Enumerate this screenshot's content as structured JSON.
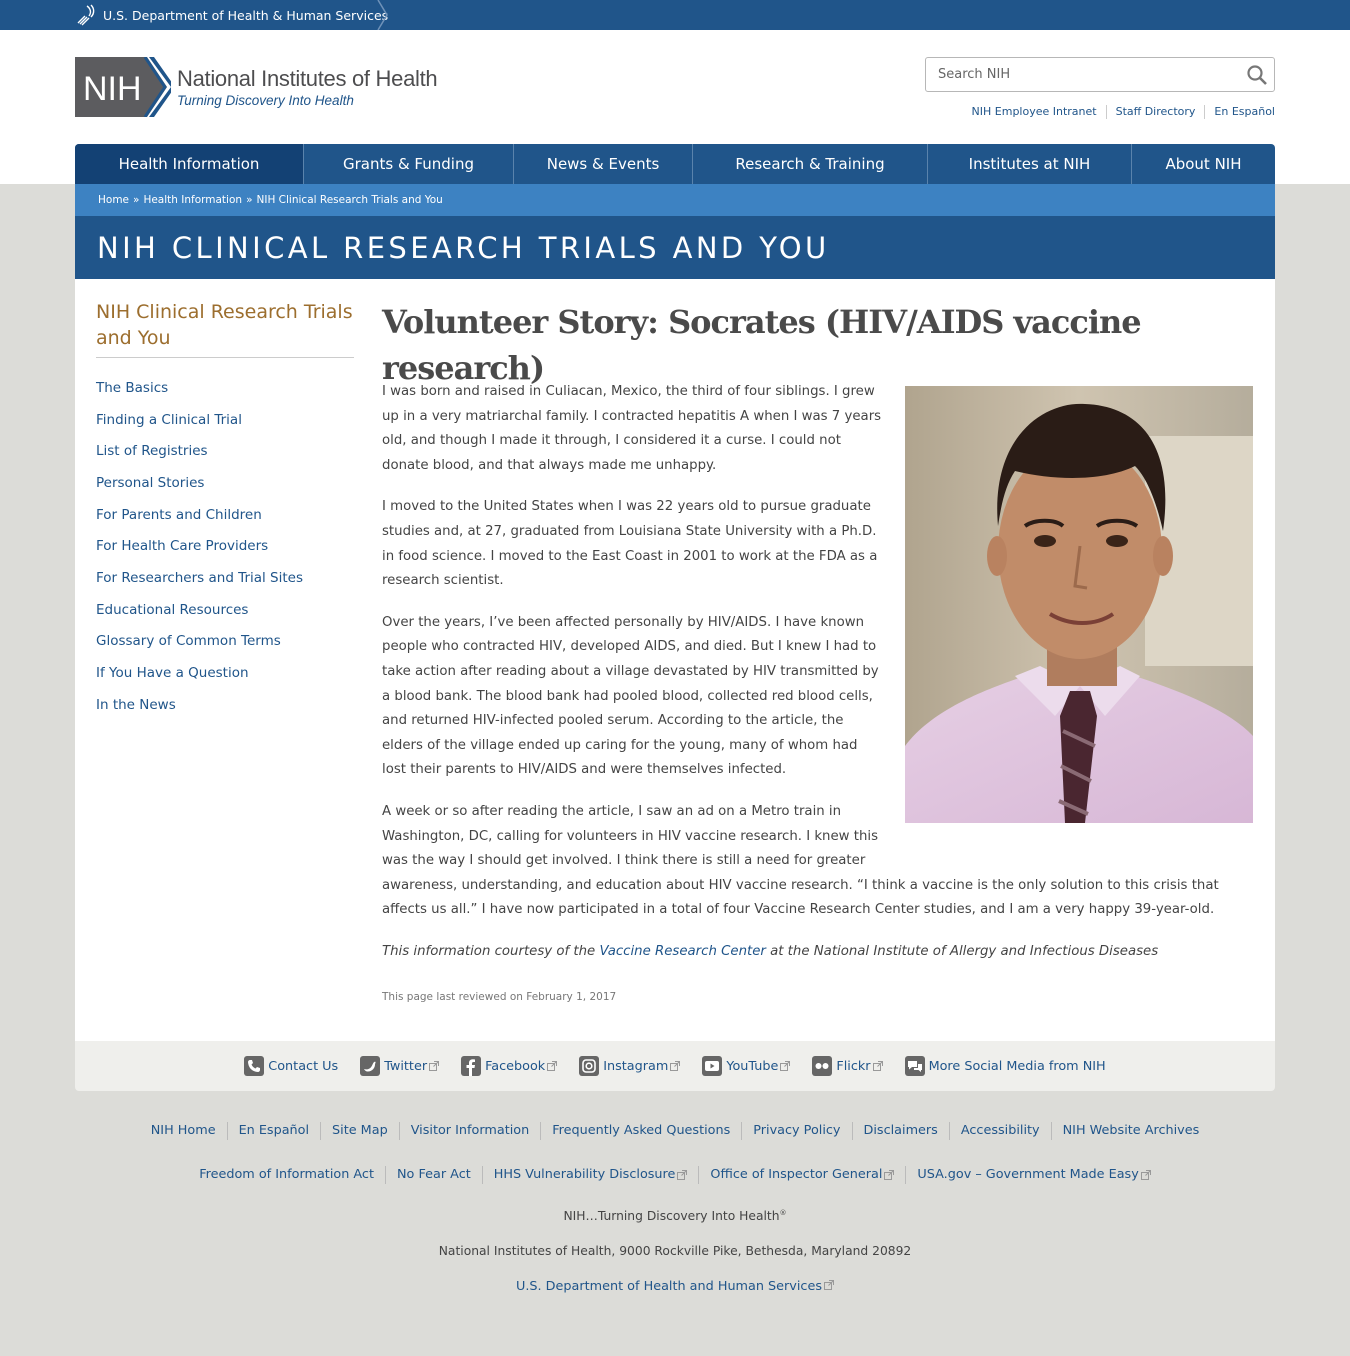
{
  "hhs": {
    "label": "U.S. Department of Health & Human Services"
  },
  "logo": {
    "mark": "NIH",
    "title": "National Institutes of Health",
    "tagline": "Turning Discovery Into Health"
  },
  "search": {
    "placeholder": "Search NIH"
  },
  "util_links": [
    "NIH Employee Intranet",
    "Staff Directory",
    "En Español"
  ],
  "nav": [
    "Health Information",
    "Grants & Funding",
    "News & Events",
    "Research & Training",
    "Institutes at NIH",
    "About NIH"
  ],
  "breadcrumb": [
    "Home",
    "Health Information",
    "NIH Clinical Research Trials and You"
  ],
  "breadcrumb_sep": "»",
  "section_title": "NIH CLINICAL RESEARCH TRIALS AND YOU",
  "sidebar": {
    "title": "NIH Clinical Research Trials and You",
    "items": [
      "The Basics",
      "Finding a Clinical Trial",
      "List of Registries",
      "Personal Stories",
      "For Parents and Children",
      "For Health Care Providers",
      "For Researchers and Trial Sites",
      "Educational Resources",
      "Glossary of Common Terms",
      "If You Have a Question",
      "In the News"
    ]
  },
  "article": {
    "heading": "Volunteer Story: Socrates (HIV/AIDS vaccine research)",
    "p1": "I was born and raised in Culiacan, Mexico, the third of four siblings. I grew up in a very matriarchal family. I contracted hepatitis A when I was 7 years old, and though I made it through, I considered it a curse. I could not donate blood, and that always made me unhappy.",
    "p2": "I moved to the United States when I was 22 years old to pursue graduate studies and, at 27, graduated from Louisiana State University with a Ph.D. in food science. I moved to the East Coast in 2001 to work at the FDA as a research scientist.",
    "p3": "Over the years, I’ve been affected personally by HIV/AIDS. I have known people who contracted HIV, developed AIDS, and died. But I knew I had to take action after reading about a village devastated by HIV transmitted by a blood bank. The blood bank had pooled blood, collected red blood cells, and returned HIV-infected pooled serum. According to the article, the elders of the village ended up caring for the young, many of whom had lost their parents to HIV/AIDS and were themselves infected.",
    "p4_line1": "A week or so after reading the article, I saw an ad on a Metro train in",
    "p4_line2": "Washington, DC, calling for volunteers in HIV vaccine research. I knew this",
    "p4_line3": "was the way I should get involved. I think there is still a need for greater",
    "p4_rest": "awareness, understanding, and education about HIV vaccine research. “I think a vaccine is the only solution to this crisis that affects us all.” I have now participated in a total of four Vaccine Research Center studies, and I am a very happy 39-year-old.",
    "courtesy_pre": "This information courtesy of the ",
    "courtesy_link": "Vaccine Research Center",
    "courtesy_post": " at the National Institute of Allergy and Infectious Diseases",
    "reviewed": "This page last reviewed on February 1, 2017"
  },
  "social": [
    "Contact Us",
    "Twitter",
    "Facebook",
    "Instagram",
    "YouTube",
    "Flickr",
    "More Social Media from NIH"
  ],
  "footer": {
    "row1": [
      "NIH Home",
      "En Español",
      "Site Map",
      "Visitor Information",
      "Frequently Asked Questions",
      "Privacy Policy",
      "Disclaimers",
      "Accessibility",
      "NIH Website Archives"
    ],
    "row2": [
      "Freedom of Information Act",
      "No Fear Act",
      "HHS Vulnerability Disclosure",
      "Office of Inspector General",
      "USA.gov – Government Made Easy"
    ],
    "tagline": "NIH…Turning Discovery Into Health",
    "tagline_mark": "®",
    "address": "National Institutes of Health, 9000 Rockville Pike, Bethesda, Maryland 20892",
    "hhs_link": "U.S. Department of Health and Human Services"
  }
}
